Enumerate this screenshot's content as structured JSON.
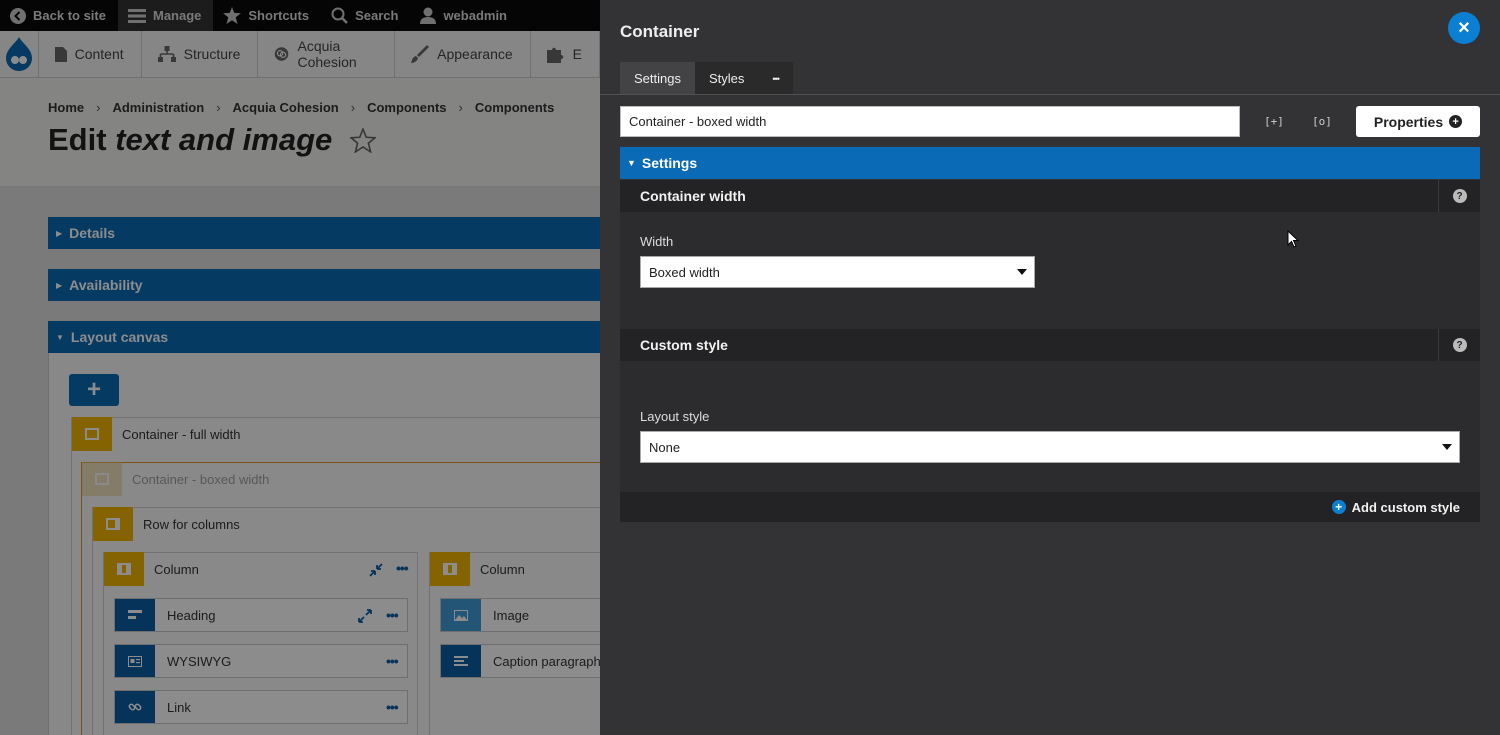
{
  "toolbar": {
    "back_label": "Back to site",
    "manage_label": "Manage",
    "shortcuts_label": "Shortcuts",
    "search_label": "Search",
    "user_label": "webadmin"
  },
  "admin_menu": {
    "items": [
      {
        "label": "Content",
        "icon": "file-icon"
      },
      {
        "label": "Structure",
        "icon": "sitemap-icon"
      },
      {
        "label": "Acquia Cohesion",
        "icon": "cohesion-icon"
      },
      {
        "label": "Appearance",
        "icon": "paintbrush-icon"
      },
      {
        "label": "E",
        "icon": "puzzle-icon"
      }
    ]
  },
  "breadcrumb": [
    "Home",
    "Administration",
    "Acquia Cohesion",
    "Components",
    "Components"
  ],
  "page_title": {
    "prefix": "Edit",
    "emphasis": "text and image"
  },
  "panels": {
    "details": "Details",
    "availability": "Availability",
    "layout_canvas": "Layout canvas"
  },
  "canvas": {
    "add_button": "+",
    "container_full": "Container - full width",
    "container_boxed": "Container - boxed width",
    "row_for_columns": "Row for columns",
    "column_left": "Column",
    "column_right": "Column",
    "elements_left": [
      "Heading",
      "WYSIWYG",
      "Link"
    ],
    "elements_right": [
      "Image",
      "Caption paragraph"
    ]
  },
  "sidebar": {
    "title": "Container",
    "close_label": "×",
    "tabs": [
      "Settings",
      "Styles"
    ],
    "more_label": "•••",
    "name_value": "Container - boxed width",
    "expand_label": "[+]",
    "focus_label": "[o]",
    "properties_label": "Properties",
    "settings_label": "Settings",
    "container_width": {
      "heading": "Container width",
      "field_label": "Width",
      "selected": "Boxed width"
    },
    "custom_style": {
      "heading": "Custom style",
      "field_label": "Layout style",
      "selected": "None",
      "add_label": "Add custom style"
    },
    "help_label": "?"
  },
  "colors": {
    "accent_blue": "#0a6ab5",
    "panel_dark": "#333335",
    "badge_yellow": "#f0b400",
    "close_blue": "#0b7fd1"
  }
}
